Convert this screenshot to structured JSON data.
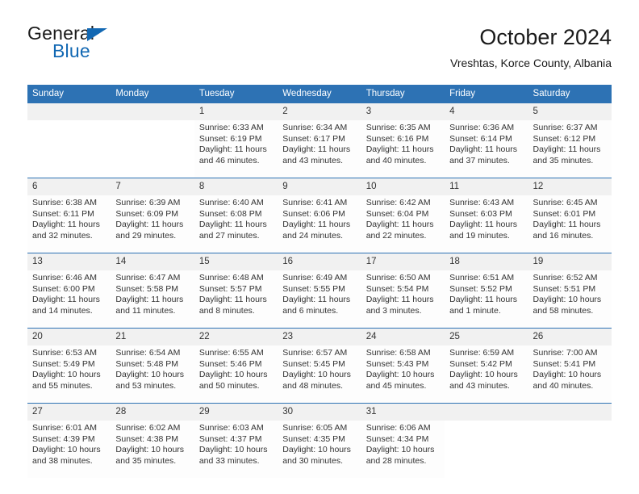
{
  "brand": {
    "name_top": "General",
    "name_bottom": "Blue",
    "triangle_color": "#1268b3"
  },
  "header": {
    "title": "October 2024",
    "subtitle": "Vreshtas, Korce County, Albania"
  },
  "theme": {
    "header_blue": "#2d72b4",
    "daynum_band": "#f1f1f1",
    "cell_bg": "#fdfdfd",
    "text": "#333333"
  },
  "calendar": {
    "weekday_headers": [
      "Sunday",
      "Monday",
      "Tuesday",
      "Wednesday",
      "Thursday",
      "Friday",
      "Saturday"
    ],
    "labels": {
      "sunrise": "Sunrise:",
      "sunset": "Sunset:",
      "daylight": "Daylight:"
    },
    "weeks": [
      [
        {
          "day": ""
        },
        {
          "day": ""
        },
        {
          "day": "1",
          "sunrise": "Sunrise: 6:33 AM",
          "sunset": "Sunset: 6:19 PM",
          "daylight_1": "Daylight: 11 hours",
          "daylight_2": "and 46 minutes."
        },
        {
          "day": "2",
          "sunrise": "Sunrise: 6:34 AM",
          "sunset": "Sunset: 6:17 PM",
          "daylight_1": "Daylight: 11 hours",
          "daylight_2": "and 43 minutes."
        },
        {
          "day": "3",
          "sunrise": "Sunrise: 6:35 AM",
          "sunset": "Sunset: 6:16 PM",
          "daylight_1": "Daylight: 11 hours",
          "daylight_2": "and 40 minutes."
        },
        {
          "day": "4",
          "sunrise": "Sunrise: 6:36 AM",
          "sunset": "Sunset: 6:14 PM",
          "daylight_1": "Daylight: 11 hours",
          "daylight_2": "and 37 minutes."
        },
        {
          "day": "5",
          "sunrise": "Sunrise: 6:37 AM",
          "sunset": "Sunset: 6:12 PM",
          "daylight_1": "Daylight: 11 hours",
          "daylight_2": "and 35 minutes."
        }
      ],
      [
        {
          "day": "6",
          "sunrise": "Sunrise: 6:38 AM",
          "sunset": "Sunset: 6:11 PM",
          "daylight_1": "Daylight: 11 hours",
          "daylight_2": "and 32 minutes."
        },
        {
          "day": "7",
          "sunrise": "Sunrise: 6:39 AM",
          "sunset": "Sunset: 6:09 PM",
          "daylight_1": "Daylight: 11 hours",
          "daylight_2": "and 29 minutes."
        },
        {
          "day": "8",
          "sunrise": "Sunrise: 6:40 AM",
          "sunset": "Sunset: 6:08 PM",
          "daylight_1": "Daylight: 11 hours",
          "daylight_2": "and 27 minutes."
        },
        {
          "day": "9",
          "sunrise": "Sunrise: 6:41 AM",
          "sunset": "Sunset: 6:06 PM",
          "daylight_1": "Daylight: 11 hours",
          "daylight_2": "and 24 minutes."
        },
        {
          "day": "10",
          "sunrise": "Sunrise: 6:42 AM",
          "sunset": "Sunset: 6:04 PM",
          "daylight_1": "Daylight: 11 hours",
          "daylight_2": "and 22 minutes."
        },
        {
          "day": "11",
          "sunrise": "Sunrise: 6:43 AM",
          "sunset": "Sunset: 6:03 PM",
          "daylight_1": "Daylight: 11 hours",
          "daylight_2": "and 19 minutes."
        },
        {
          "day": "12",
          "sunrise": "Sunrise: 6:45 AM",
          "sunset": "Sunset: 6:01 PM",
          "daylight_1": "Daylight: 11 hours",
          "daylight_2": "and 16 minutes."
        }
      ],
      [
        {
          "day": "13",
          "sunrise": "Sunrise: 6:46 AM",
          "sunset": "Sunset: 6:00 PM",
          "daylight_1": "Daylight: 11 hours",
          "daylight_2": "and 14 minutes."
        },
        {
          "day": "14",
          "sunrise": "Sunrise: 6:47 AM",
          "sunset": "Sunset: 5:58 PM",
          "daylight_1": "Daylight: 11 hours",
          "daylight_2": "and 11 minutes."
        },
        {
          "day": "15",
          "sunrise": "Sunrise: 6:48 AM",
          "sunset": "Sunset: 5:57 PM",
          "daylight_1": "Daylight: 11 hours",
          "daylight_2": "and 8 minutes."
        },
        {
          "day": "16",
          "sunrise": "Sunrise: 6:49 AM",
          "sunset": "Sunset: 5:55 PM",
          "daylight_1": "Daylight: 11 hours",
          "daylight_2": "and 6 minutes."
        },
        {
          "day": "17",
          "sunrise": "Sunrise: 6:50 AM",
          "sunset": "Sunset: 5:54 PM",
          "daylight_1": "Daylight: 11 hours",
          "daylight_2": "and 3 minutes."
        },
        {
          "day": "18",
          "sunrise": "Sunrise: 6:51 AM",
          "sunset": "Sunset: 5:52 PM",
          "daylight_1": "Daylight: 11 hours",
          "daylight_2": "and 1 minute."
        },
        {
          "day": "19",
          "sunrise": "Sunrise: 6:52 AM",
          "sunset": "Sunset: 5:51 PM",
          "daylight_1": "Daylight: 10 hours",
          "daylight_2": "and 58 minutes."
        }
      ],
      [
        {
          "day": "20",
          "sunrise": "Sunrise: 6:53 AM",
          "sunset": "Sunset: 5:49 PM",
          "daylight_1": "Daylight: 10 hours",
          "daylight_2": "and 55 minutes."
        },
        {
          "day": "21",
          "sunrise": "Sunrise: 6:54 AM",
          "sunset": "Sunset: 5:48 PM",
          "daylight_1": "Daylight: 10 hours",
          "daylight_2": "and 53 minutes."
        },
        {
          "day": "22",
          "sunrise": "Sunrise: 6:55 AM",
          "sunset": "Sunset: 5:46 PM",
          "daylight_1": "Daylight: 10 hours",
          "daylight_2": "and 50 minutes."
        },
        {
          "day": "23",
          "sunrise": "Sunrise: 6:57 AM",
          "sunset": "Sunset: 5:45 PM",
          "daylight_1": "Daylight: 10 hours",
          "daylight_2": "and 48 minutes."
        },
        {
          "day": "24",
          "sunrise": "Sunrise: 6:58 AM",
          "sunset": "Sunset: 5:43 PM",
          "daylight_1": "Daylight: 10 hours",
          "daylight_2": "and 45 minutes."
        },
        {
          "day": "25",
          "sunrise": "Sunrise: 6:59 AM",
          "sunset": "Sunset: 5:42 PM",
          "daylight_1": "Daylight: 10 hours",
          "daylight_2": "and 43 minutes."
        },
        {
          "day": "26",
          "sunrise": "Sunrise: 7:00 AM",
          "sunset": "Sunset: 5:41 PM",
          "daylight_1": "Daylight: 10 hours",
          "daylight_2": "and 40 minutes."
        }
      ],
      [
        {
          "day": "27",
          "sunrise": "Sunrise: 6:01 AM",
          "sunset": "Sunset: 4:39 PM",
          "daylight_1": "Daylight: 10 hours",
          "daylight_2": "and 38 minutes."
        },
        {
          "day": "28",
          "sunrise": "Sunrise: 6:02 AM",
          "sunset": "Sunset: 4:38 PM",
          "daylight_1": "Daylight: 10 hours",
          "daylight_2": "and 35 minutes."
        },
        {
          "day": "29",
          "sunrise": "Sunrise: 6:03 AM",
          "sunset": "Sunset: 4:37 PM",
          "daylight_1": "Daylight: 10 hours",
          "daylight_2": "and 33 minutes."
        },
        {
          "day": "30",
          "sunrise": "Sunrise: 6:05 AM",
          "sunset": "Sunset: 4:35 PM",
          "daylight_1": "Daylight: 10 hours",
          "daylight_2": "and 30 minutes."
        },
        {
          "day": "31",
          "sunrise": "Sunrise: 6:06 AM",
          "sunset": "Sunset: 4:34 PM",
          "daylight_1": "Daylight: 10 hours",
          "daylight_2": "and 28 minutes."
        },
        {
          "day": ""
        },
        {
          "day": ""
        }
      ]
    ]
  }
}
